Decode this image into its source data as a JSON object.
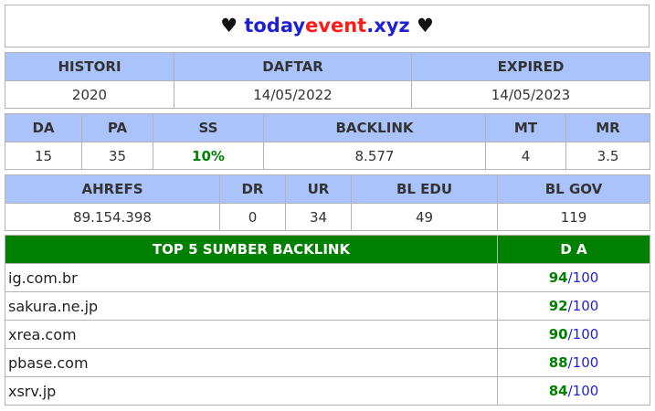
{
  "header": {
    "heart_left": "♥",
    "site_part1": "today",
    "site_part2": "event",
    "site_part3": ".xyz",
    "heart_right": "♥"
  },
  "table1": {
    "headers": [
      "HISTORI",
      "DAFTAR",
      "EXPIRED"
    ],
    "values": [
      "2020",
      "14/05/2022",
      "14/05/2023"
    ]
  },
  "table2": {
    "headers": [
      "DA",
      "PA",
      "SS",
      "BACKLINK",
      "MT",
      "MR"
    ],
    "values": [
      "15",
      "35",
      "10%",
      "8.577",
      "4",
      "3.5"
    ]
  },
  "table3": {
    "headers": [
      "AHREFS",
      "DR",
      "UR",
      "BL EDU",
      "BL GOV"
    ],
    "values": [
      "89.154.398",
      "0",
      "34",
      "49",
      "119"
    ]
  },
  "top_backlinks": {
    "header_left": "TOP 5 SUMBER BACKLINK",
    "header_right": "D A",
    "max": "/100",
    "rows": [
      {
        "domain": "ig.com.br",
        "da": "94"
      },
      {
        "domain": "sakura.ne.jp",
        "da": "92"
      },
      {
        "domain": "xrea.com",
        "da": "90"
      },
      {
        "domain": "pbase.com",
        "da": "88"
      },
      {
        "domain": "xsrv.jp",
        "da": "84"
      }
    ]
  },
  "colors": {
    "header_bg": "#aac3fb",
    "top_header_bg": "#008000",
    "accent_green": "#008000",
    "accent_blue": "#1f1fd6",
    "accent_red": "#ff1a1a"
  }
}
